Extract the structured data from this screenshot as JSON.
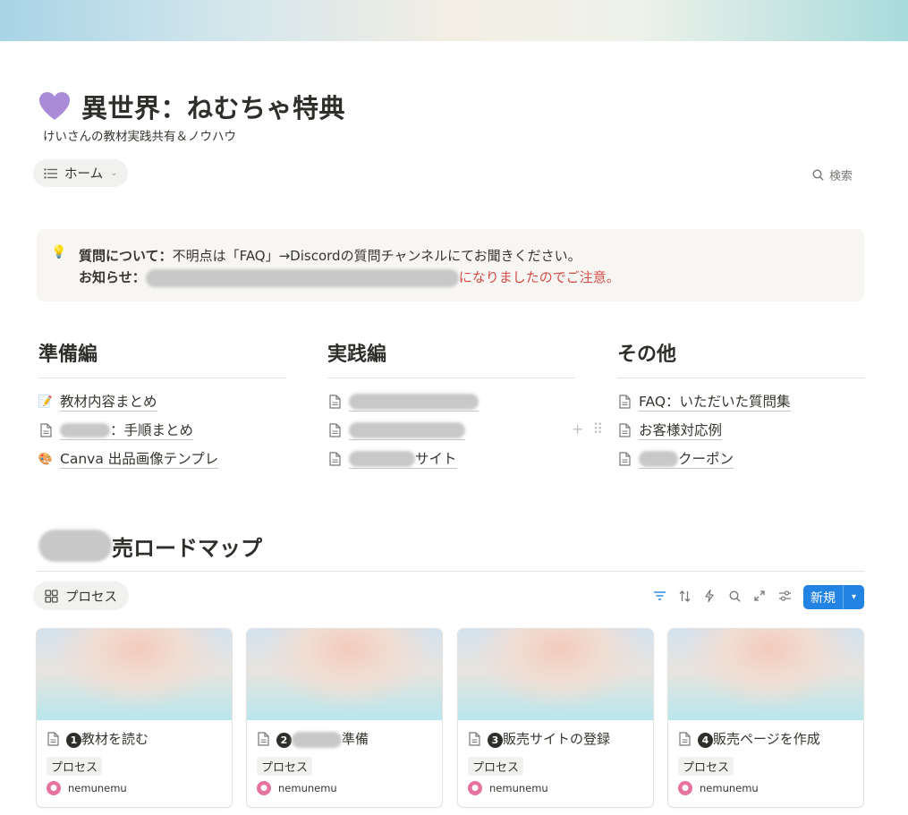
{
  "header": {
    "title": "異世界：ねむちゃ特典",
    "subtitle": "けいさんの教材実践共有＆ノウハウ",
    "heart_color": "#a98bd9"
  },
  "toolbar": {
    "view_label": "ホーム",
    "search_label": "検索"
  },
  "callout": {
    "line1_bold": "質問について：",
    "line1_text": "不明点は「FAQ」→Discordの質問チャンネルにてお聞きください。",
    "line2_bold": "お知らせ：",
    "line2_visible_tail": "になりましたのでご注意。"
  },
  "columns": [
    {
      "heading": "準備編",
      "items": [
        {
          "icon": "memo-icon",
          "label": "教材内容まとめ"
        },
        {
          "icon": "page-icon",
          "label": "：手順まとめ"
        },
        {
          "icon": "palette-icon",
          "label": "Canva 出品画像テンプレ"
        }
      ]
    },
    {
      "heading": "実践編",
      "items": [
        {
          "icon": "page-icon",
          "label": ""
        },
        {
          "icon": "page-icon",
          "label": ""
        },
        {
          "icon": "page-icon",
          "label": "サイト"
        }
      ]
    },
    {
      "heading": "その他",
      "items": [
        {
          "icon": "page-icon",
          "label": "FAQ：いただいた質問集"
        },
        {
          "icon": "page-icon",
          "label": "お客様対応例"
        },
        {
          "icon": "page-icon",
          "label": "クーポン"
        }
      ]
    }
  ],
  "database": {
    "title_visible": "売ロードマップ",
    "view_label": "プロセス",
    "new_label": "新規",
    "accent_color": "#2383e2",
    "cards": [
      {
        "num": "1",
        "title": "教材を読む",
        "tag": "プロセス",
        "owner": "nemunemu"
      },
      {
        "num": "2",
        "title": "準備",
        "tag": "プロセス",
        "owner": "nemunemu"
      },
      {
        "num": "3",
        "title": "販売サイトの登録",
        "tag": "プロセス",
        "owner": "nemunemu"
      },
      {
        "num": "4",
        "title": "販売ページを作成",
        "tag": "プロセス",
        "owner": "nemunemu"
      }
    ]
  }
}
